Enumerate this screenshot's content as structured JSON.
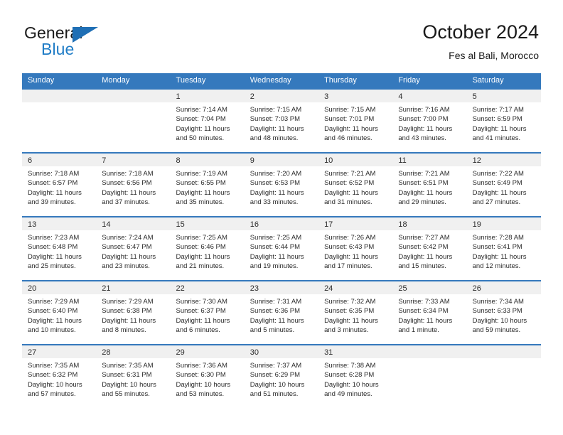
{
  "brand": {
    "name_top": "General",
    "name_bottom": "Blue",
    "triangle_color": "#1f6fb5",
    "blue_text_color": "#1f7cc6"
  },
  "header": {
    "title": "October 2024",
    "subtitle": "Fes al Bali, Morocco"
  },
  "theme": {
    "header_blue": "#3579bd",
    "date_band_gray": "#f0f0f0",
    "text_color": "#2b2b2b"
  },
  "weekday_headers": [
    "Sunday",
    "Monday",
    "Tuesday",
    "Wednesday",
    "Thursday",
    "Friday",
    "Saturday"
  ],
  "weeks": [
    [
      {
        "date": "",
        "lines": []
      },
      {
        "date": "",
        "lines": []
      },
      {
        "date": "1",
        "lines": [
          "Sunrise: 7:14 AM",
          "Sunset: 7:04 PM",
          "Daylight: 11 hours",
          "and 50 minutes."
        ]
      },
      {
        "date": "2",
        "lines": [
          "Sunrise: 7:15 AM",
          "Sunset: 7:03 PM",
          "Daylight: 11 hours",
          "and 48 minutes."
        ]
      },
      {
        "date": "3",
        "lines": [
          "Sunrise: 7:15 AM",
          "Sunset: 7:01 PM",
          "Daylight: 11 hours",
          "and 46 minutes."
        ]
      },
      {
        "date": "4",
        "lines": [
          "Sunrise: 7:16 AM",
          "Sunset: 7:00 PM",
          "Daylight: 11 hours",
          "and 43 minutes."
        ]
      },
      {
        "date": "5",
        "lines": [
          "Sunrise: 7:17 AM",
          "Sunset: 6:59 PM",
          "Daylight: 11 hours",
          "and 41 minutes."
        ]
      }
    ],
    [
      {
        "date": "6",
        "lines": [
          "Sunrise: 7:18 AM",
          "Sunset: 6:57 PM",
          "Daylight: 11 hours",
          "and 39 minutes."
        ]
      },
      {
        "date": "7",
        "lines": [
          "Sunrise: 7:18 AM",
          "Sunset: 6:56 PM",
          "Daylight: 11 hours",
          "and 37 minutes."
        ]
      },
      {
        "date": "8",
        "lines": [
          "Sunrise: 7:19 AM",
          "Sunset: 6:55 PM",
          "Daylight: 11 hours",
          "and 35 minutes."
        ]
      },
      {
        "date": "9",
        "lines": [
          "Sunrise: 7:20 AM",
          "Sunset: 6:53 PM",
          "Daylight: 11 hours",
          "and 33 minutes."
        ]
      },
      {
        "date": "10",
        "lines": [
          "Sunrise: 7:21 AM",
          "Sunset: 6:52 PM",
          "Daylight: 11 hours",
          "and 31 minutes."
        ]
      },
      {
        "date": "11",
        "lines": [
          "Sunrise: 7:21 AM",
          "Sunset: 6:51 PM",
          "Daylight: 11 hours",
          "and 29 minutes."
        ]
      },
      {
        "date": "12",
        "lines": [
          "Sunrise: 7:22 AM",
          "Sunset: 6:49 PM",
          "Daylight: 11 hours",
          "and 27 minutes."
        ]
      }
    ],
    [
      {
        "date": "13",
        "lines": [
          "Sunrise: 7:23 AM",
          "Sunset: 6:48 PM",
          "Daylight: 11 hours",
          "and 25 minutes."
        ]
      },
      {
        "date": "14",
        "lines": [
          "Sunrise: 7:24 AM",
          "Sunset: 6:47 PM",
          "Daylight: 11 hours",
          "and 23 minutes."
        ]
      },
      {
        "date": "15",
        "lines": [
          "Sunrise: 7:25 AM",
          "Sunset: 6:46 PM",
          "Daylight: 11 hours",
          "and 21 minutes."
        ]
      },
      {
        "date": "16",
        "lines": [
          "Sunrise: 7:25 AM",
          "Sunset: 6:44 PM",
          "Daylight: 11 hours",
          "and 19 minutes."
        ]
      },
      {
        "date": "17",
        "lines": [
          "Sunrise: 7:26 AM",
          "Sunset: 6:43 PM",
          "Daylight: 11 hours",
          "and 17 minutes."
        ]
      },
      {
        "date": "18",
        "lines": [
          "Sunrise: 7:27 AM",
          "Sunset: 6:42 PM",
          "Daylight: 11 hours",
          "and 15 minutes."
        ]
      },
      {
        "date": "19",
        "lines": [
          "Sunrise: 7:28 AM",
          "Sunset: 6:41 PM",
          "Daylight: 11 hours",
          "and 12 minutes."
        ]
      }
    ],
    [
      {
        "date": "20",
        "lines": [
          "Sunrise: 7:29 AM",
          "Sunset: 6:40 PM",
          "Daylight: 11 hours",
          "and 10 minutes."
        ]
      },
      {
        "date": "21",
        "lines": [
          "Sunrise: 7:29 AM",
          "Sunset: 6:38 PM",
          "Daylight: 11 hours",
          "and 8 minutes."
        ]
      },
      {
        "date": "22",
        "lines": [
          "Sunrise: 7:30 AM",
          "Sunset: 6:37 PM",
          "Daylight: 11 hours",
          "and 6 minutes."
        ]
      },
      {
        "date": "23",
        "lines": [
          "Sunrise: 7:31 AM",
          "Sunset: 6:36 PM",
          "Daylight: 11 hours",
          "and 5 minutes."
        ]
      },
      {
        "date": "24",
        "lines": [
          "Sunrise: 7:32 AM",
          "Sunset: 6:35 PM",
          "Daylight: 11 hours",
          "and 3 minutes."
        ]
      },
      {
        "date": "25",
        "lines": [
          "Sunrise: 7:33 AM",
          "Sunset: 6:34 PM",
          "Daylight: 11 hours",
          "and 1 minute."
        ]
      },
      {
        "date": "26",
        "lines": [
          "Sunrise: 7:34 AM",
          "Sunset: 6:33 PM",
          "Daylight: 10 hours",
          "and 59 minutes."
        ]
      }
    ],
    [
      {
        "date": "27",
        "lines": [
          "Sunrise: 7:35 AM",
          "Sunset: 6:32 PM",
          "Daylight: 10 hours",
          "and 57 minutes."
        ]
      },
      {
        "date": "28",
        "lines": [
          "Sunrise: 7:35 AM",
          "Sunset: 6:31 PM",
          "Daylight: 10 hours",
          "and 55 minutes."
        ]
      },
      {
        "date": "29",
        "lines": [
          "Sunrise: 7:36 AM",
          "Sunset: 6:30 PM",
          "Daylight: 10 hours",
          "and 53 minutes."
        ]
      },
      {
        "date": "30",
        "lines": [
          "Sunrise: 7:37 AM",
          "Sunset: 6:29 PM",
          "Daylight: 10 hours",
          "and 51 minutes."
        ]
      },
      {
        "date": "31",
        "lines": [
          "Sunrise: 7:38 AM",
          "Sunset: 6:28 PM",
          "Daylight: 10 hours",
          "and 49 minutes."
        ]
      },
      {
        "date": "",
        "lines": []
      },
      {
        "date": "",
        "lines": []
      }
    ]
  ]
}
